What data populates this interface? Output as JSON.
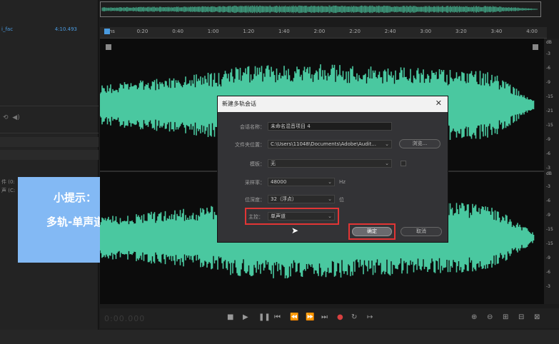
{
  "left_panel": {
    "file_name": "i_fac",
    "file_duration": "4:10.493",
    "items": [
      {
        "label": "件 (0:"
      },
      {
        "label": "声 (C:"
      }
    ]
  },
  "tip": {
    "title": "小提示：",
    "text": "多轨-单声道-创建"
  },
  "ruler": {
    "labels": [
      "hms",
      "0:20",
      "0:40",
      "1:00",
      "1:20",
      "1:40",
      "2:00",
      "2:20",
      "2:40",
      "3:00",
      "3:20",
      "3:40",
      "4:00"
    ]
  },
  "db_scale": {
    "top_unit": "dB",
    "top_labels": [
      "-3",
      "-6",
      "-9",
      "-15",
      "-21",
      "-15",
      "-9",
      "-6",
      "-3"
    ],
    "bottom_unit": "dB",
    "bottom_labels": [
      "-3",
      "-6",
      "-9",
      "-15",
      "-15",
      "-9",
      "-6",
      "-3"
    ]
  },
  "transport": {
    "timecode": "0:00.000"
  },
  "dialog": {
    "title": "新建多轨会话",
    "fields": {
      "session_name": {
        "label": "会话名称：",
        "value": "未命名混音项目 4"
      },
      "folder": {
        "label": "文件夹位置：",
        "value": "C:\\Users\\11048\\Documents\\Adobe\\Audit...",
        "browse": "浏览..."
      },
      "template": {
        "label": "模板：",
        "value": "无"
      },
      "sample_rate": {
        "label": "采样率：",
        "value": "48000",
        "unit": "Hz"
      },
      "bit_depth": {
        "label": "位深度：",
        "value": "32（浮点）",
        "unit": "位"
      },
      "master": {
        "label": "主控：",
        "value": "单声道"
      }
    },
    "ok_label": "确定",
    "cancel_label": "取消"
  },
  "colors": {
    "waveform": "#4ac8a0",
    "highlight": "#e23535",
    "tip_bg": "#83b9f4",
    "accent": "#4a9be0"
  }
}
